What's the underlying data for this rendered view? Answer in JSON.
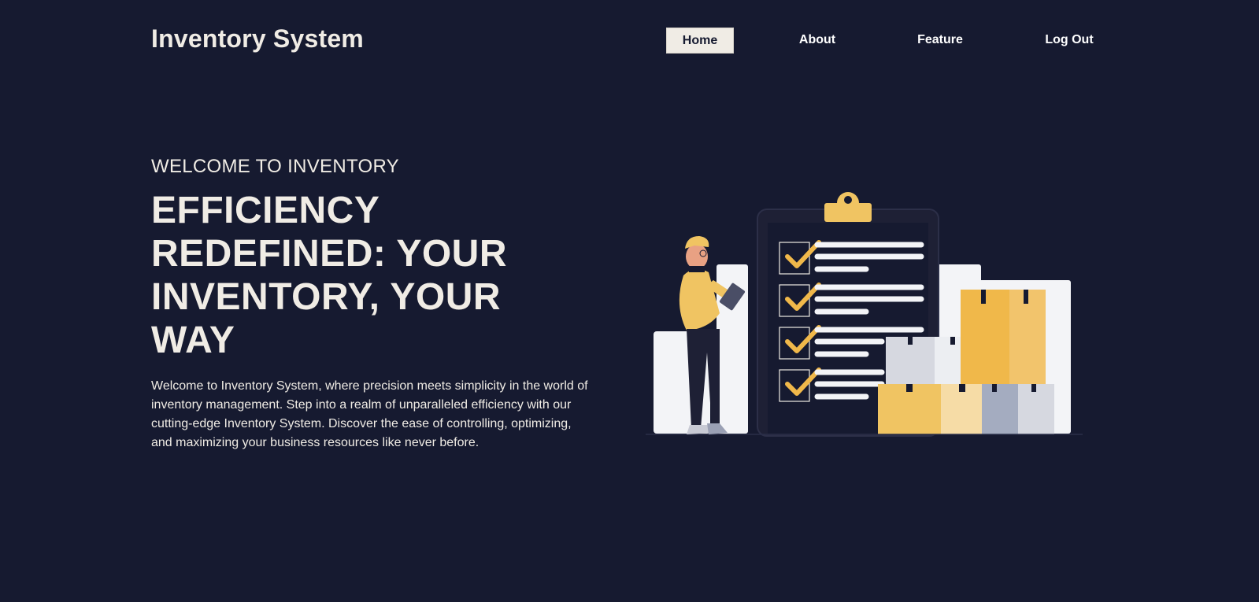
{
  "header": {
    "brand": "Inventory System",
    "nav": [
      {
        "label": "Home",
        "active": true
      },
      {
        "label": "About",
        "active": false
      },
      {
        "label": "Feature",
        "active": false
      },
      {
        "label": "Log Out",
        "active": false
      }
    ]
  },
  "hero": {
    "kicker": "WELCOME TO INVENTORY",
    "headline": "EFFICIENCY REDEFINED: YOUR INVENTORY, YOUR WAY",
    "intro": "Welcome to Inventory System, where precision meets simplicity in the world of inventory management. Step into a realm of unparalleled efficiency with our cutting-edge Inventory System. Discover the ease of controlling, optimizing, and maximizing your business resources like never before."
  },
  "colors": {
    "background": "#161a30",
    "text": "#f0ece5",
    "accent": "#f0b84a",
    "panel": "#f3f4f7"
  },
  "illustration": {
    "icon": "inventory-checklist-illustration"
  }
}
